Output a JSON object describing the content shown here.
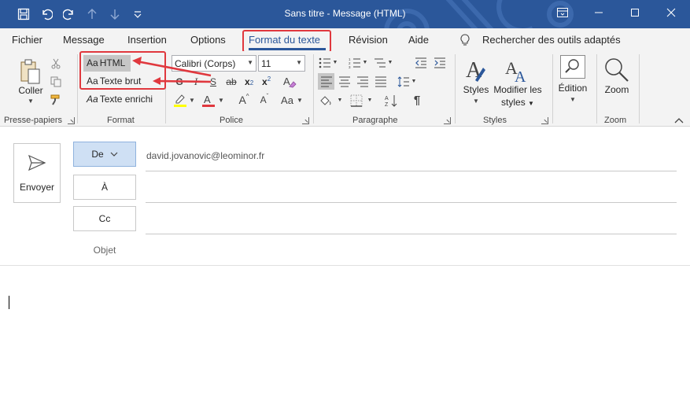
{
  "titlebar": {
    "title": "Sans titre  -  Message (HTML)",
    "icons": [
      "save-icon",
      "undo-icon",
      "redo-icon",
      "arrow-up-icon",
      "arrow-down-icon",
      "customize-qat-icon"
    ],
    "bg_color": "#2b579a"
  },
  "tabs": [
    {
      "label": "Fichier"
    },
    {
      "label": "Message"
    },
    {
      "label": "Insertion"
    },
    {
      "label": "Options"
    },
    {
      "label": "Format du texte",
      "active": true
    },
    {
      "label": "Révision"
    },
    {
      "label": "Aide"
    }
  ],
  "search": {
    "label": "Rechercher des outils adaptés"
  },
  "ribbon": {
    "clipboard": {
      "paste_label": "Coller",
      "group_label": "Presse-papiers"
    },
    "format": {
      "html_label": "HTML",
      "plain_label": "Texte brut",
      "rich_label": "Texte enrichi",
      "aa": "Aa",
      "group_label": "Format"
    },
    "font": {
      "font_name": "Calibri (Corps)",
      "font_size": "11",
      "bold": "G",
      "italic": "I",
      "underline": "S",
      "strike": "ab",
      "sub": "x",
      "sup": "x",
      "grow": "A",
      "shrink": "A",
      "case": "Aa",
      "group_label": "Police"
    },
    "paragraph": {
      "group_label": "Paragraphe"
    },
    "styles": {
      "styles_label": "Styles",
      "modify_label_1": "Modifier les",
      "modify_label_2": "styles",
      "group_label": "Styles"
    },
    "editing": {
      "label": "Édition"
    },
    "zoom": {
      "label": "Zoom",
      "group_label": "Zoom"
    }
  },
  "compose": {
    "send_label": "Envoyer",
    "from_label": "De",
    "from_value": "david.jovanovic@leominor.fr",
    "to_label": "À",
    "cc_label": "Cc",
    "subject_label": "Objet"
  },
  "colors": {
    "accent": "#2b579a",
    "annotation": "#e0383e",
    "highlight": "#ffff00",
    "font_color": "#e0383e"
  }
}
